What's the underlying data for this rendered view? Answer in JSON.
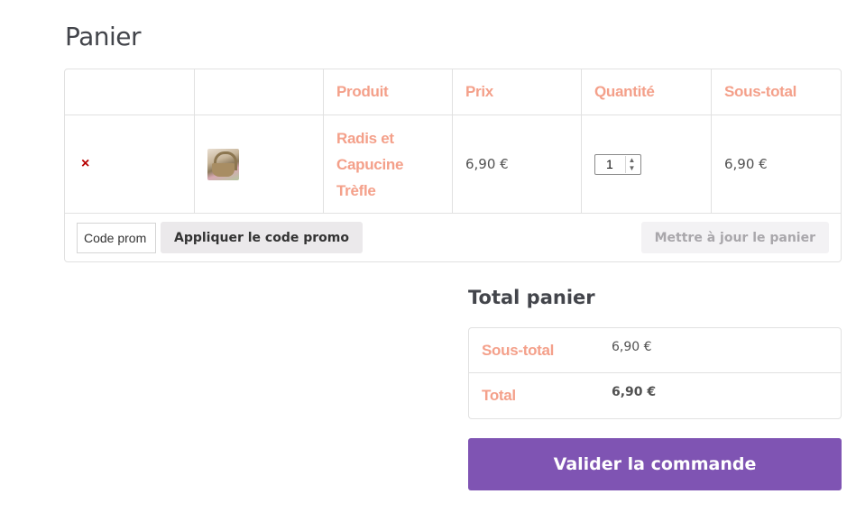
{
  "page": {
    "title": "Panier"
  },
  "cart": {
    "headers": [
      "",
      "",
      "Produit",
      "Prix",
      "Quantité",
      "Sous-total"
    ],
    "items": [
      {
        "remove_icon": "×",
        "thumbnail": "basket-image",
        "product_lines": [
          "Radis et",
          "Capucine",
          "Trèfle"
        ],
        "price": "6,90 €",
        "quantity": "1",
        "subtotal": "6,90 €"
      }
    ],
    "coupon_placeholder": "Code prom",
    "apply_coupon_label": "Appliquer le code promo",
    "update_cart_label": "Mettre à jour le panier"
  },
  "totals": {
    "title": "Total panier",
    "subtotal_label": "Sous-total",
    "subtotal_value": "6,90 €",
    "total_label": "Total",
    "total_value": "6,90 €"
  },
  "checkout": {
    "label": "Valider la commande",
    "color": "#7f54b3"
  },
  "colors": {
    "heading_accent": "#f4a08a",
    "remove": "#b60000"
  }
}
